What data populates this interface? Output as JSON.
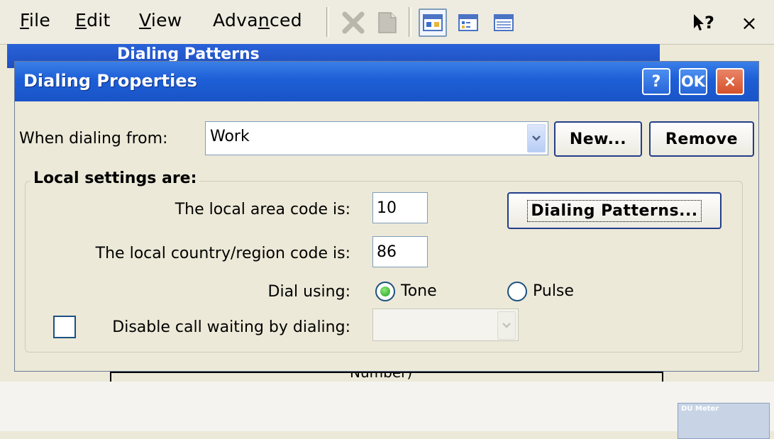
{
  "menubar": {
    "items": [
      {
        "label_pre": "",
        "label_ul": "F",
        "label_post": "ile"
      },
      {
        "label_pre": "",
        "label_ul": "E",
        "label_post": "dit"
      },
      {
        "label_pre": "",
        "label_ul": "V",
        "label_post": "iew"
      },
      {
        "label_pre": "Adva",
        "label_ul": "n",
        "label_post": "ced"
      }
    ],
    "toolbar_icons": [
      "delete-icon",
      "properties-icon",
      "large-icons-view-icon",
      "small-icons-view-icon",
      "details-view-icon"
    ],
    "help_glyph": "?",
    "close_glyph": "×"
  },
  "background_window": {
    "title": "Dialing Patterns",
    "status_text": "Number)"
  },
  "dialog": {
    "title": "Dialing Properties",
    "help_label": "?",
    "ok_label": "OK",
    "close_label": "×",
    "when_dialing_from_label": "When dialing from:",
    "location_value": "Work",
    "new_button": "New...",
    "remove_button": "Remove",
    "group_label": "Local settings are:",
    "area_code_label": "The local area code is:",
    "area_code_value": "10",
    "dialing_patterns_button": "Dialing Patterns...",
    "country_code_label": "The local country/region code is:",
    "country_code_value": "86",
    "dial_using_label": "Dial using:",
    "tone_label": "Tone",
    "pulse_label": "Pulse",
    "dial_mode": "Tone",
    "disable_call_waiting_label": "Disable call waiting by dialing:",
    "disable_call_waiting_checked": false
  },
  "tray": {
    "du_meter_title": "DU Meter"
  },
  "colors": {
    "titlebar": "#1d5ed6",
    "dialog_bg": "#ece9d8",
    "close_button": "#d5512c",
    "radio_selected": "#21a121"
  }
}
